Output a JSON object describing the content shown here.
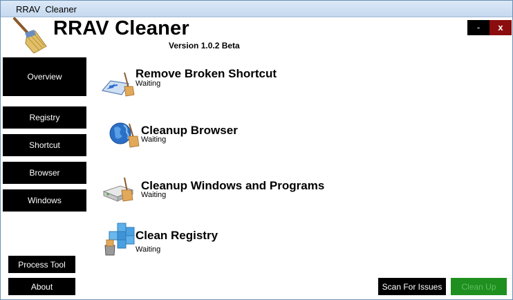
{
  "window": {
    "title": "RRAV  Cleaner"
  },
  "header": {
    "app_name": "RRAV Cleaner",
    "version": "Version 1.0.2 Beta",
    "minimize_label": "-",
    "close_label": "x",
    "logo_icon": "broom-icon"
  },
  "sidebar": {
    "overview": "Overview",
    "items": [
      "Registry",
      "Shortcut",
      "Browser",
      "Windows"
    ],
    "process_tool": "Process Tool",
    "about": "About"
  },
  "tasks": [
    {
      "name": "Remove Broken Shortcut",
      "status": "Waiting",
      "icon": "broken-shortcut-icon"
    },
    {
      "name": "Cleanup Browser",
      "status": "Waiting",
      "icon": "browser-globe-icon"
    },
    {
      "name": "Cleanup Windows and Programs",
      "status": "Waiting",
      "icon": "drive-cleanup-icon"
    },
    {
      "name": "Clean Registry",
      "status": "Waiting",
      "icon": "registry-cubes-icon"
    }
  ],
  "actions": {
    "scan": "Scan For Issues",
    "clean": "Clean Up"
  },
  "colors": {
    "nav_bg": "#000000",
    "close_bg": "#8b0d0d",
    "clean_bg": "#1f8f1f",
    "clean_text": "#5fbf5f"
  }
}
